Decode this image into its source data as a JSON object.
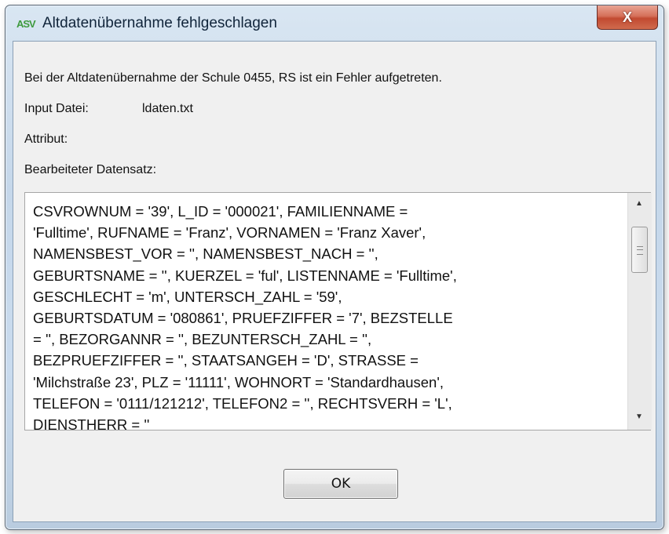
{
  "window": {
    "title": "Altdatenübernahme fehlgeschlagen",
    "close_glyph": "X",
    "app_icon_glyph": "A",
    "app_icon_glyph_2": "SV"
  },
  "dialog": {
    "message": "Bei der Altdatenübernahme der Schule 0455, RS ist ein Fehler aufgetreten.",
    "input_label": "Input Datei:",
    "input_value": "ldaten.txt",
    "attribute_label": "Attribut:",
    "record_label": "Bearbeiteter Datensatz:",
    "record_text": "CSVROWNUM = '39', L_ID = '000021', FAMILIENNAME = 'Fulltime', RUFNAME = 'Franz', VORNAMEN = 'Franz Xaver', NAMENSBEST_VOR = '', NAMENSBEST_NACH = '', GEBURTSNAME = '', KUERZEL = 'ful', LISTENNAME = 'Fulltime', GESCHLECHT = 'm', UNTERSCH_ZAHL = '59', GEBURTSDATUM = '080861', PRUEFZIFFER = '7', BEZSTELLE = '', BEZORGANNR = '', BEZUNTERSCH_ZAHL = '', BEZPRUEFZIFFER = '', STAATSANGEH = 'D', STRASSE = 'Milchstraße 23', PLZ = '11111', WOHNORT = 'Standardhausen', TELEFON = '0111/121212', TELEFON2 = '', RECHTSVERH = 'L', DIENSTHERR = ''",
    "ok_label": "OK"
  },
  "colors": {
    "close_button": "#c24a31",
    "titlebar": "#c5d7ea"
  }
}
